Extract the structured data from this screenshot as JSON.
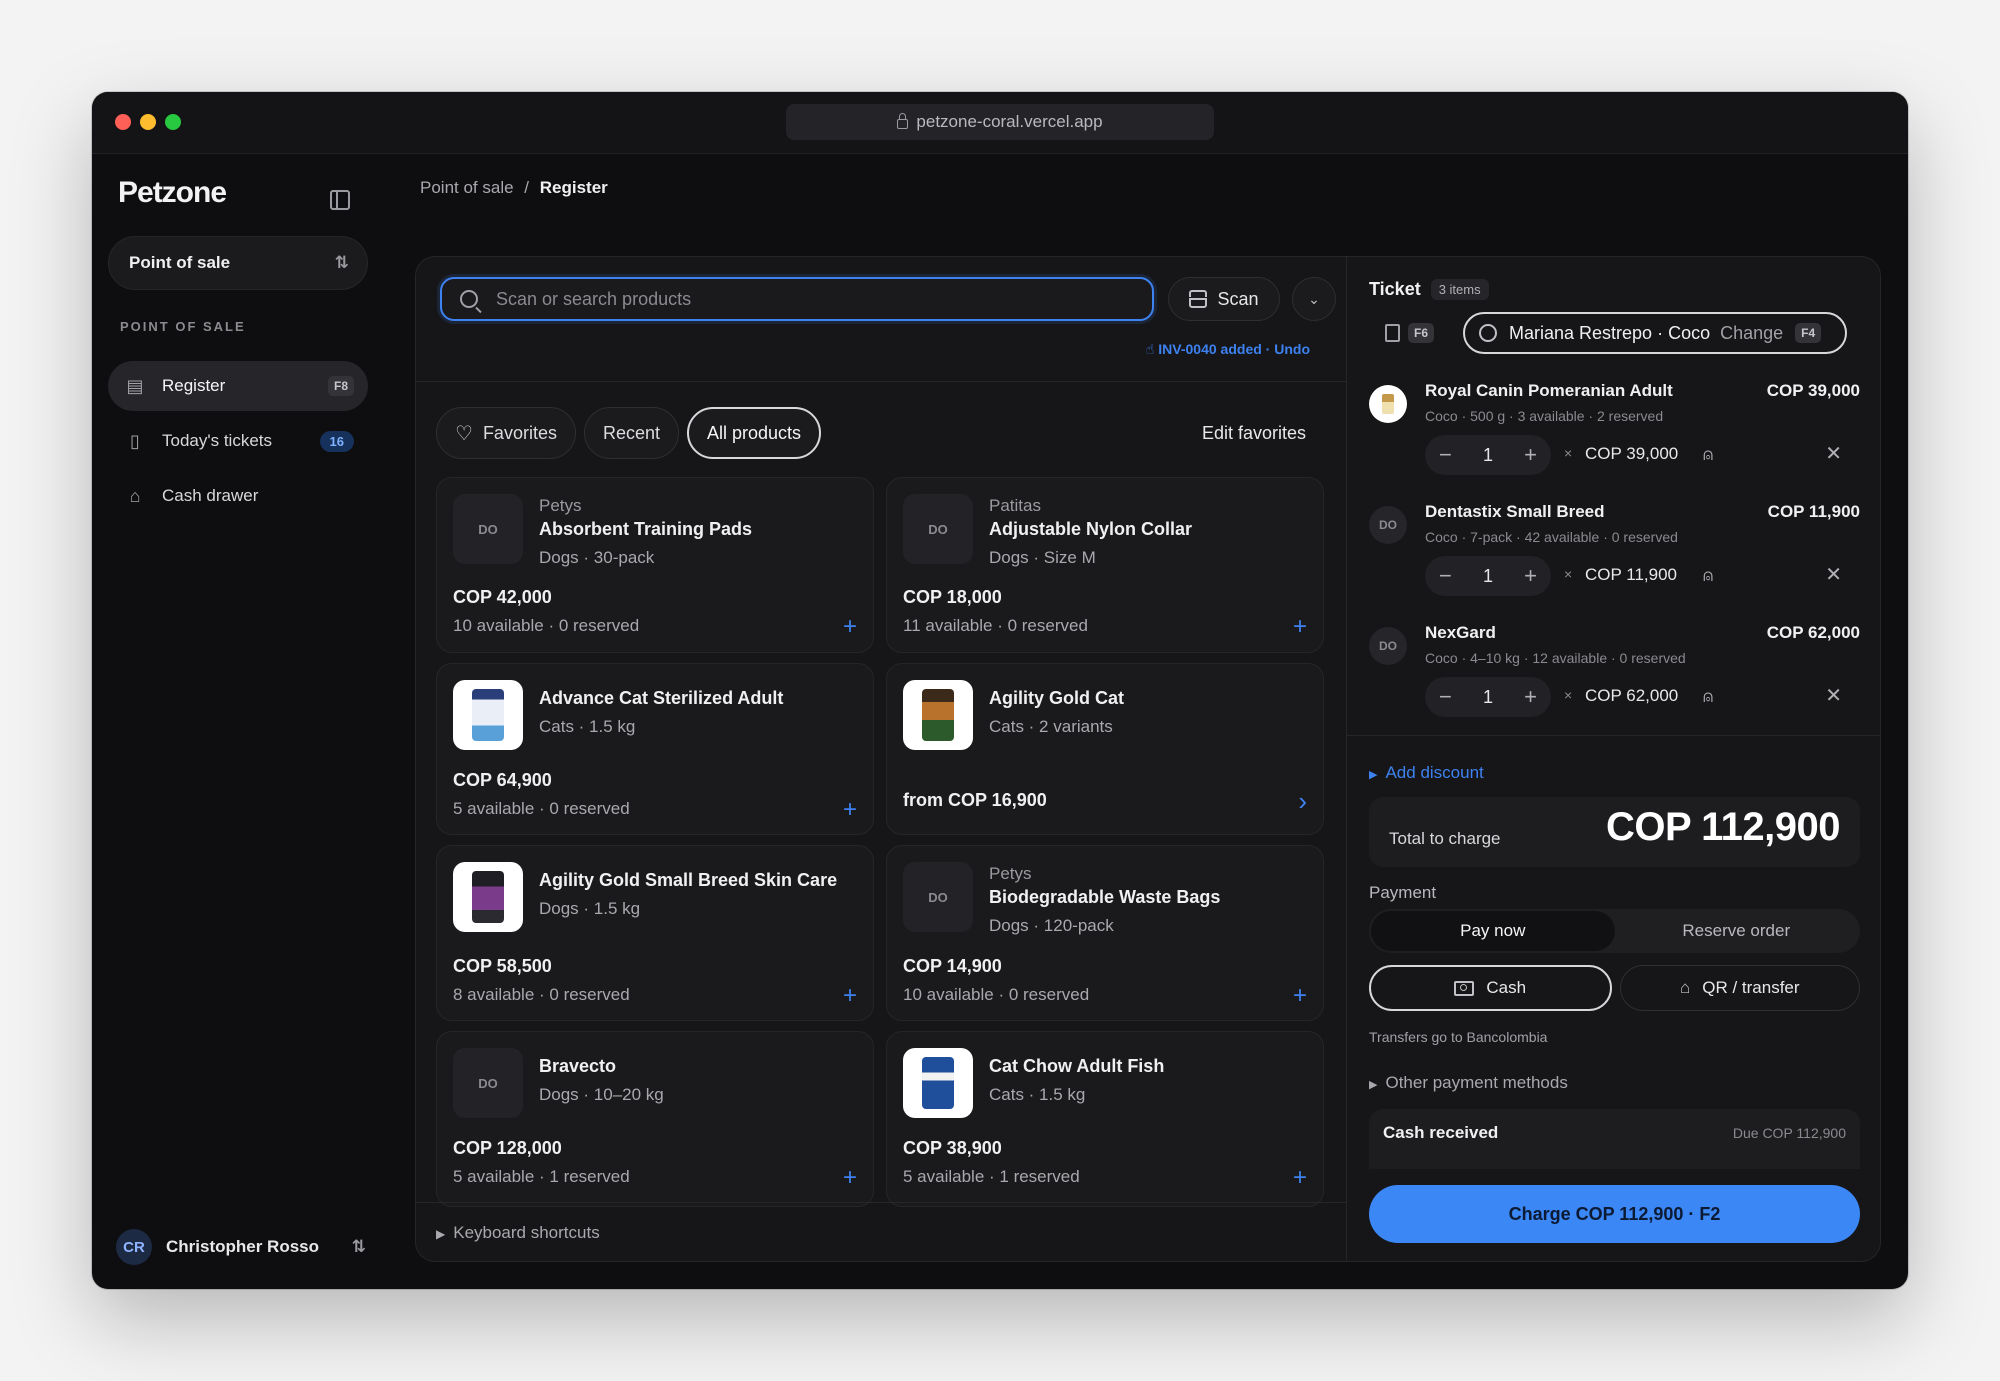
{
  "browser": {
    "url": "petzone-coral.vercel.app"
  },
  "sidebar": {
    "brand": "Petzone",
    "switcher": "Point of sale",
    "section_label": "POINT OF SALE",
    "items": [
      {
        "label": "Register",
        "shortcut": "F8",
        "icon": "register-icon"
      },
      {
        "label": "Today's tickets",
        "badge": "16",
        "icon": "receipt-icon"
      },
      {
        "label": "Cash drawer",
        "icon": "bank-icon"
      }
    ],
    "user": {
      "initials": "CR",
      "name": "Christopher Rosso"
    }
  },
  "breadcrumb": {
    "parent": "Point of sale",
    "separator": "/",
    "current": "Register"
  },
  "search": {
    "placeholder": "Scan or search products",
    "scan_label": "Scan"
  },
  "notice": "INV-0040 added · Undo",
  "tabs": {
    "favorites": "Favorites",
    "recent": "Recent",
    "all": "All products",
    "edit": "Edit favorites"
  },
  "products": [
    {
      "brand": "Petys",
      "name": "Absorbent Training Pads",
      "sub": "Dogs · 30-pack",
      "price": "COP 42,000",
      "stock": "10 available · 0 reserved",
      "thumb": "DO",
      "action": "+"
    },
    {
      "brand": "Patitas",
      "name": "Adjustable Nylon Collar",
      "sub": "Dogs · Size M",
      "price": "COP 18,000",
      "stock": "11 available · 0 reserved",
      "thumb": "DO",
      "action": "+"
    },
    {
      "brand": "",
      "name": "Advance Cat Sterilized Adult",
      "sub": "Cats · 1.5 kg",
      "price": "COP 64,900",
      "stock": "5 available · 0 reserved",
      "thumb": "",
      "action": "+"
    },
    {
      "brand": "",
      "name": "Agility Gold Cat",
      "sub": "Cats · 2 variants",
      "price": "from COP 16,900",
      "stock": "",
      "thumb": "",
      "action": "›"
    },
    {
      "brand": "",
      "name": "Agility Gold Small Breed Skin Care",
      "sub": "Dogs · 1.5 kg",
      "price": "COP 58,500",
      "stock": "8 available · 0 reserved",
      "thumb": "",
      "action": "+"
    },
    {
      "brand": "Petys",
      "name": "Biodegradable Waste Bags",
      "sub": "Dogs · 120-pack",
      "price": "COP 14,900",
      "stock": "10 available · 0 reserved",
      "thumb": "DO",
      "action": "+"
    },
    {
      "brand": "",
      "name": "Bravecto",
      "sub": "Dogs · 10–20 kg",
      "price": "COP 128,000",
      "stock": "5 available · 1 reserved",
      "thumb": "DO",
      "action": "+"
    },
    {
      "brand": "",
      "name": "Cat Chow Adult Fish",
      "sub": "Cats · 1.5 kg",
      "price": "COP 38,900",
      "stock": "5 available · 1 reserved",
      "thumb": "",
      "action": "+"
    }
  ],
  "keyboard_shortcuts": "Keyboard shortcuts",
  "ticket": {
    "title": "Ticket",
    "count": "3 items",
    "receipt_shortcut": "F6",
    "customer": {
      "name": "Mariana Restrepo · Coco",
      "change": "Change",
      "shortcut": "F4"
    },
    "lines": [
      {
        "name": "Royal Canin Pomeranian Adult",
        "meta": "Coco · 500 g · 3 available · 2 reserved",
        "qty": "1",
        "unit": "COP 39,000",
        "total": "COP 39,000",
        "thumb": ""
      },
      {
        "name": "Dentastix Small Breed",
        "meta": "Coco · 7-pack · 42 available · 0 reserved",
        "qty": "1",
        "unit": "COP 11,900",
        "total": "COP 11,900",
        "thumb": "DO"
      },
      {
        "name": "NexGard",
        "meta": "Coco · 4–10 kg · 12 available · 0 reserved",
        "qty": "1",
        "unit": "COP 62,000",
        "total": "COP 62,000",
        "thumb": "DO"
      }
    ],
    "add_discount": "Add discount",
    "total_label": "Total to charge",
    "total_value": "COP 112,900",
    "payment_label": "Payment",
    "pay_now": "Pay now",
    "reserve": "Reserve order",
    "cash": "Cash",
    "qr": "QR / transfer",
    "transfer_note": "Transfers go to Bancolombia",
    "other_methods": "Other payment methods",
    "cash_received": "Cash received",
    "due": "Due COP 112,900",
    "charge": "Charge COP 112,900 · F2"
  },
  "colors": {
    "accent": "#3b87f5",
    "background": "#0e0e10",
    "panel": "#161618"
  }
}
